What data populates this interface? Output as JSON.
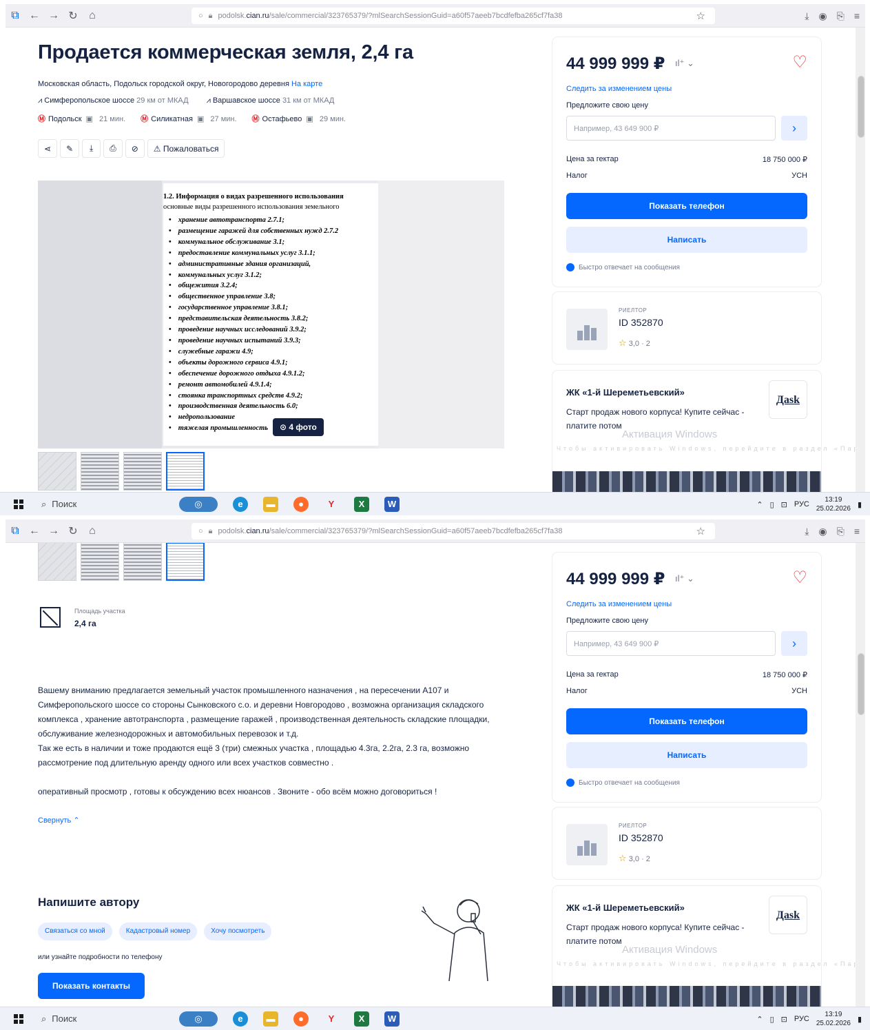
{
  "browser": {
    "url_prefix": "podolsk.",
    "url_domain": "cian.ru",
    "url_rest": "/sale/commercial/323765379/?mlSearchSessionGuid=a60f57aeeb7bcdfefba265cf7fa38",
    "icons": [
      "back-icon",
      "forward-icon",
      "reload-icon",
      "home-icon"
    ]
  },
  "listing": {
    "title": "Продается коммерческая земля, 2,4 га",
    "address": "Московская область, Подольск городской округ, Новогородово деревня",
    "map_link": "На карте",
    "highways": [
      {
        "name": "Симферопольское шоссе",
        "dist": "29 км от МКАД"
      },
      {
        "name": "Варшавское шоссе",
        "dist": "31 км от МКАД"
      }
    ],
    "metro": [
      {
        "name": "Подольск",
        "time": "21 мин."
      },
      {
        "name": "Силикатная",
        "time": "27 мин."
      },
      {
        "name": "Остафьево",
        "time": "29 мин."
      }
    ],
    "complain": "Пожаловаться",
    "photo_count": "4 фото",
    "document": {
      "heading": "1.2. Информация о видах разрешенного использования",
      "subheading": "основные виды разрешенного использования земельного",
      "items": [
        "хранение автотранспорта 2.7.1;",
        "размещение гаражей для собственных нужд 2.7.2",
        "коммунальное обслуживание 3.1;",
        "предоставление коммунальных услуг 3.1.1;",
        "административные здания организаций,",
        "коммунальных услуг 3.1.2;",
        "общежития 3.2.4;",
        "общественное управление 3.8;",
        "государственное управление 3.8.1;",
        "представительская деятельность 3.8.2;",
        "проведение научных исследований 3.9.2;",
        "проведение научных испытаний 3.9.3;",
        "служебные гаражи 4.9;",
        "объекты дорожного сервиса 4.9.1;",
        "обеспечение дорожного отдыха 4.9.1.2;",
        "ремонт автомобилей 4.9.1.4;",
        "стоянка транспортных средств 4.9.2;",
        "производственная деятельность 6.0;",
        "недропользование",
        "тяжелая промышленность"
      ]
    },
    "area_label": "Площадь участка",
    "area_value": "2,4 га",
    "description": [
      "Вашему вниманию предлагается земельный участок промышленного назначения , на пересечении А107 и Симферопольского шоссе со стороны Сынковского с.о. и деревни Новгородово , возможна организация складского комплекса , хранение автотранспорта , размещение гаражей , производственная деятельность складские площадки, обслуживание железнодорожных и автомобильных перевозок и т.д.",
      "Так же есть в наличии и тоже продаются ещё 3 (три) смежных участка , площадью 4.3га, 2.2га, 2.3 га, возможно рассмотрение под длительную аренду одного или всех участков совместно .",
      "оперативный просмотр , готовы к обсуждению всех нюансов . Звоните - обо всём можно договориться !"
    ],
    "collapse": "Свернуть",
    "write_title": "Напишите автору",
    "chips": [
      "Связаться со мной",
      "Кадастровый номер",
      "Хочу посмотреть"
    ],
    "or_phone": "или узнайте подробности по телефону",
    "show_contacts": "Показать контакты"
  },
  "sidebar": {
    "price": "44 999 999 ₽",
    "follow": "Следить за изменением цены",
    "offer": "Предложите свою цену",
    "offer_placeholder": "Например, 43 649 900 ₽",
    "rows": [
      {
        "k": "Цена за гектар",
        "v": "18 750 000 ₽"
      },
      {
        "k": "Налог",
        "v": "УСН"
      }
    ],
    "show_phone": "Показать телефон",
    "write": "Написать",
    "fast_reply": "Быстро отвечает на сообщения",
    "agent_role": "РИЕЛТОР",
    "agent_id": "ID 352870",
    "agent_rating": "3,0 · 2",
    "ad_title": "ЖК «1-й Шереметьевский»",
    "ad_text": "Старт продаж нового корпуса! Купите сейчас - платите потом",
    "ad_logo": "Дask",
    "watermark": "Активация Windows",
    "watermark_small": "Чтобы активировать Windows, перейдите в раздел «Параметры»."
  },
  "taskbar": {
    "search": "Поиск",
    "lang": "РУС",
    "time": "13:19",
    "date": "25.02.2026"
  },
  "colors": {
    "accent": "#0468ff",
    "text": "#152242",
    "danger": "#e5262a"
  }
}
